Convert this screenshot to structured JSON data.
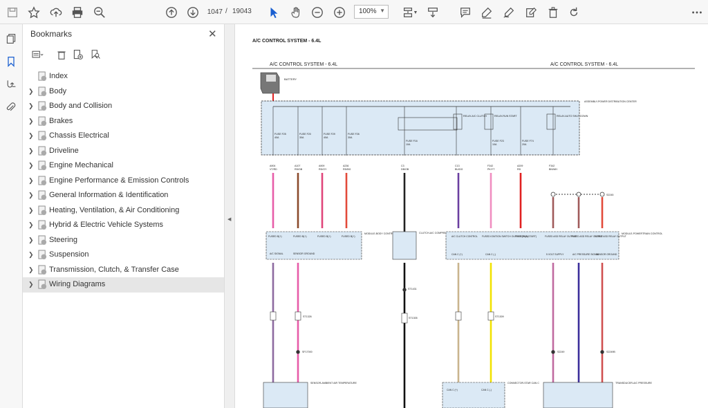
{
  "toolbar": {
    "page_current": "1047",
    "page_separator": "/",
    "page_total": "19043",
    "zoom": "100%",
    "icons": [
      "save-icon",
      "star-icon",
      "upload-icon",
      "print-icon",
      "zoom-search-icon",
      "page-up-icon",
      "page-down-icon",
      "select-cursor-icon",
      "hand-icon",
      "zoom-out-icon",
      "zoom-in-icon",
      "page-fit-icon",
      "scroll-mode-icon",
      "comment-icon",
      "highlight-icon",
      "draw-icon",
      "fill-sign-icon",
      "delete-icon",
      "rotate-icon",
      "more-icon"
    ]
  },
  "sidebar": {
    "title": "Bookmarks",
    "close_glyph": "✕",
    "bookmarks": [
      {
        "label": "Index",
        "expandable": false
      },
      {
        "label": "Body",
        "expandable": true
      },
      {
        "label": "Body and Collision",
        "expandable": true
      },
      {
        "label": "Brakes",
        "expandable": true
      },
      {
        "label": "Chassis Electrical",
        "expandable": true
      },
      {
        "label": "Driveline",
        "expandable": true
      },
      {
        "label": "Engine Mechanical",
        "expandable": true
      },
      {
        "label": "Engine Performance & Emission Controls",
        "expandable": true
      },
      {
        "label": "General Information & Identification",
        "expandable": true
      },
      {
        "label": "Heating, Ventilation, & Air Conditioning",
        "expandable": true
      },
      {
        "label": "Hybrid & Electric Vehicle Systems",
        "expandable": true
      },
      {
        "label": "Steering",
        "expandable": true
      },
      {
        "label": "Suspension",
        "expandable": true
      },
      {
        "label": "Transmission, Clutch, & Transfer Case",
        "expandable": true
      },
      {
        "label": "Wiring Diagrams",
        "expandable": true,
        "selected": true
      }
    ]
  },
  "diagram": {
    "page_heading": "A/C CONTROL SYSTEM - 6.4L",
    "header_left": "A/C CONTROL SYSTEM - 6.4L",
    "header_right": "A/C CONTROL SYSTEM - 6.4L",
    "battery_label": "BATTERY",
    "pdc_label": "ASSEMBLY-POWER DISTRIBUTION CENTER",
    "fuses": [
      {
        "name": "FUSE F25",
        "amps": "40A"
      },
      {
        "name": "FUSE F20",
        "amps": "30A"
      },
      {
        "name": "FUSE F29",
        "amps": "40A"
      },
      {
        "name": "FUSE F26",
        "amps": "30A"
      },
      {
        "name": "FUSE F16",
        "amps": "10A"
      },
      {
        "name": "FUSE F23",
        "amps": "10A"
      },
      {
        "name": "FUSE F74",
        "amps": "20A"
      }
    ],
    "relays": [
      "RELAY-A/C CLUTCH",
      "RELAY-RUN START",
      "RELAY-AUTO SHUT DOWN"
    ],
    "wires": [
      {
        "circuit": "A904",
        "color_code": "VT/RD",
        "hex": "#e75ca8"
      },
      {
        "circuit": "A107",
        "color_code": "RD/DB",
        "hex": "#8b4a2b"
      },
      {
        "circuit": "A909",
        "color_code": "RD/GY",
        "hex": "#e0457a"
      },
      {
        "circuit": "A236",
        "color_code": "RD/BG",
        "hex": "#e24a3a"
      },
      {
        "circuit": "C3",
        "color_code": "DB/OB",
        "hex": "#222222"
      },
      {
        "circuit": "C13",
        "color_code": "BU/DG",
        "hex": "#6b3fa0"
      },
      {
        "circuit": "F342",
        "color_code": "PK/YT",
        "hex": "#f08dc0"
      },
      {
        "circuit": "A209",
        "color_code": "RD",
        "hex": "#e02020"
      },
      {
        "circuit": "F342",
        "color_code": "BN/WH",
        "hex": "#a05a5a"
      }
    ],
    "bcm_label": "MODULE-BODY CONTROL",
    "bcm_pins": [
      "FUSED B(+)",
      "FUSED B(+)",
      "FUSED B(+)",
      "FUSED B(+)"
    ],
    "bcm_lower": [
      "A/C SIGNAL",
      "SENSOR GROUND"
    ],
    "clutch_label": "CLUTCH-A/C COMPRESSOR",
    "pcm_label": "MODULE-POWERTRAIN CONTROL",
    "pcm_pins": [
      "A/C CLUTCH CONTROL",
      "FUSED IGNITION SWITCH OUTPUT (RUN-START)",
      "FUSED B(+)",
      "FUSED ASD RELAY OUTPUT",
      "FUSED ASD RELAY OUTPUT",
      "FUSED ASD RELAY OUTPUT"
    ],
    "pcm_lower": [
      "CAN C (+)",
      "CAN C (-)",
      "5 VOLT SUPPLY",
      "A/C PRESSURE SIGNAL",
      "SENSOR GROUND"
    ],
    "sensor_left": "SENSOR-AMBIENT AIR TEMPERATURE",
    "connector_star": "CONNECTOR-STAR CAN C",
    "transducer": "TRANSDUCER-A/C PRESSURE",
    "splices": [
      "ST1326",
      "ST1431",
      "SF17000",
      "ST1309",
      "ST1305",
      "S2249",
      "S2249B",
      "S2245"
    ],
    "can_labels": [
      "CAN C (+)",
      "CAN C (-)"
    ]
  }
}
